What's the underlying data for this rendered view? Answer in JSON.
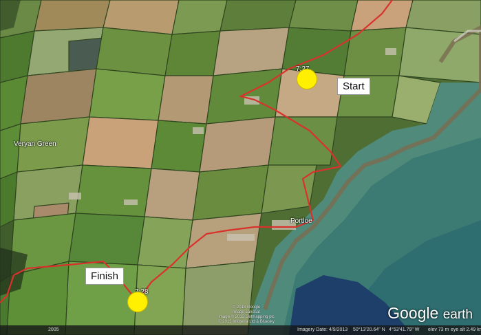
{
  "places": {
    "veryan_green": "Veryan Green",
    "portloe": "Portloe"
  },
  "route_color": "#d9322c",
  "markers": {
    "start_label": "Start",
    "finish_label": "Finish",
    "start_time": "7:27",
    "finish_time": "7:28",
    "marker_color": "#ffef00"
  },
  "copyrights": {
    "line1": "© 2013 Google",
    "line2": "Image Landsat",
    "line3": "Image © 2013 Getmapping plc",
    "line4": "© 2013 Infoterra Ltd & Bluesky"
  },
  "brand": {
    "google": "Google",
    "earth": "earth"
  },
  "status_bar": {
    "scale": "2005",
    "imagery_date": "Imagery Date: 4/9/2013",
    "latitude": "50°13'20.64\" N",
    "longitude": "4°53'41.79\" W",
    "elevation": "elev   73 m",
    "eye_alt": "eye alt   2.49 km"
  }
}
